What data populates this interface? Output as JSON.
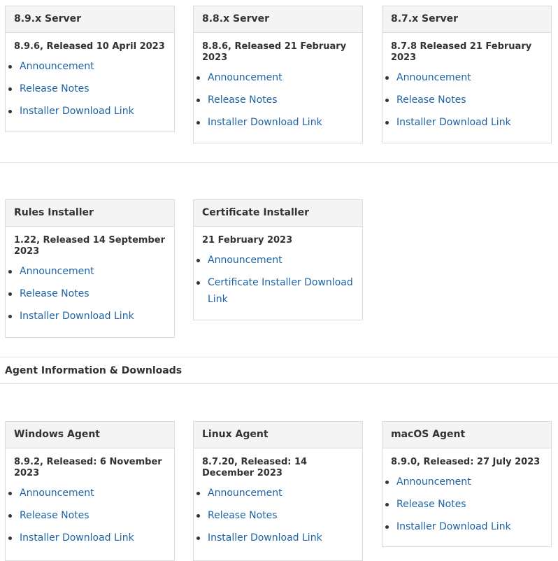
{
  "server_cards": [
    {
      "title": "8.9.x Server",
      "release": "8.9.6, Released 10 April 2023",
      "links": [
        "Announcement",
        "Release Notes",
        "Installer Download Link"
      ]
    },
    {
      "title": "8.8.x Server",
      "release": "8.8.6, Released 21 February 2023",
      "links": [
        "Announcement",
        "Release Notes",
        "Installer Download Link"
      ]
    },
    {
      "title": "8.7.x Server",
      "release": "8.7.8 Released 21 February 2023",
      "links": [
        "Announcement",
        "Release Notes",
        "Installer Download Link"
      ]
    }
  ],
  "installer_cards": [
    {
      "title": "Rules Installer",
      "release": "1.22, Released 14 September 2023",
      "links": [
        "Announcement",
        "Release Notes",
        "Installer Download Link"
      ]
    },
    {
      "title": "Certificate Installer",
      "release": "21 February 2023",
      "links": [
        "Announcement",
        "Certificate Installer Download Link"
      ]
    }
  ],
  "agent_section": {
    "title": "Agent Information & Downloads"
  },
  "agent_cards": [
    {
      "title": "Windows Agent",
      "release": "8.9.2, Released: 6 November 2023",
      "links": [
        "Announcement",
        "Release Notes",
        "Installer Download Link"
      ]
    },
    {
      "title": "Linux Agent",
      "release": "8.7.20, Released: 14 December 2023",
      "links": [
        "Announcement",
        "Release Notes",
        "Installer Download Link"
      ]
    },
    {
      "title": "macOS Agent",
      "release": "8.9.0, Released: 27 July 2023",
      "links": [
        "Announcement",
        "Release Notes",
        "Installer Download Link"
      ]
    }
  ],
  "colors": {
    "link": "#1d63a6",
    "header_bg": "#f4f4f4",
    "border": "#dcdcdc"
  }
}
